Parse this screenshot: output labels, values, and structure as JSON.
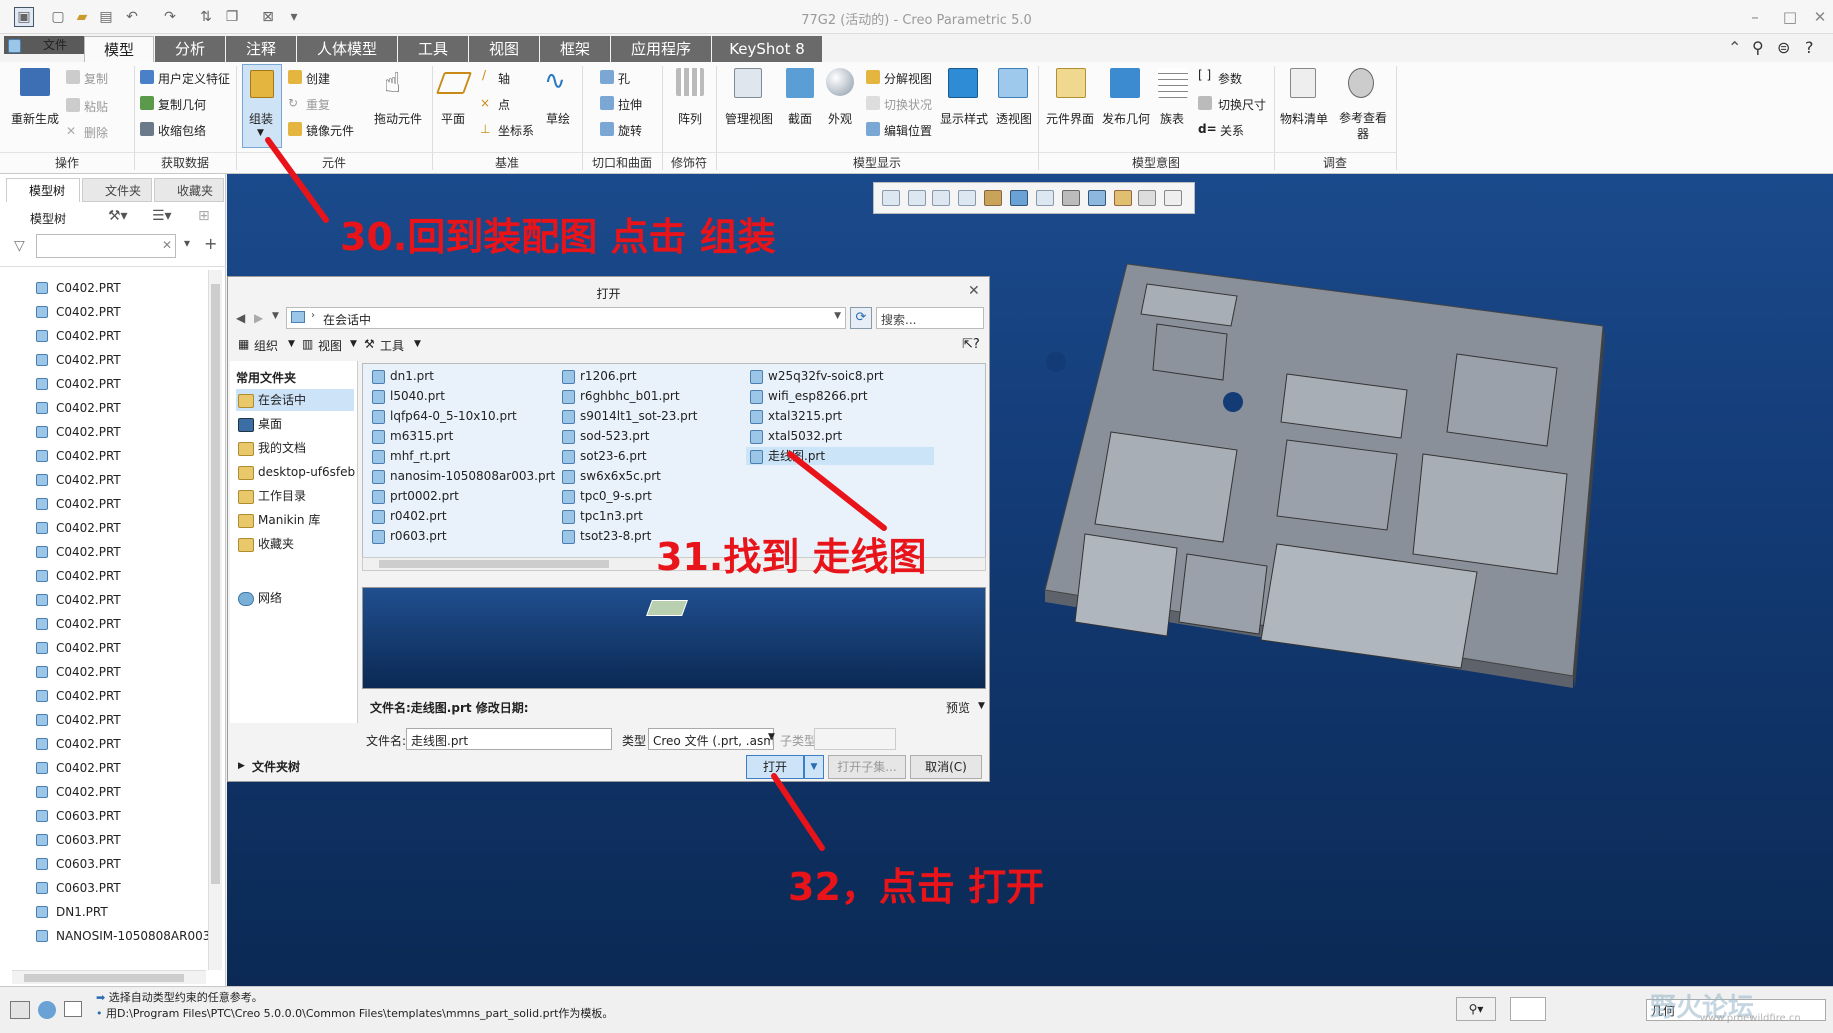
{
  "window": {
    "title": "77G2 (活动的) - Creo Parametric 5.0"
  },
  "tabs": [
    {
      "label": "文件"
    },
    {
      "label": "模型"
    },
    {
      "label": "分析"
    },
    {
      "label": "注释"
    },
    {
      "label": "人体模型"
    },
    {
      "label": "工具"
    },
    {
      "label": "视图"
    },
    {
      "label": "框架"
    },
    {
      "label": "应用程序"
    },
    {
      "label": "KeyShot 8"
    }
  ],
  "ribbon": {
    "regenerate": "重新生成",
    "copy": "复制",
    "paste": "粘贴",
    "delete": "删除",
    "udf": "用户定义特征",
    "copy_geom": "复制几何",
    "shrinkwrap": "收缩包络",
    "assemble": "组装",
    "create": "创建",
    "repeat": "重复",
    "mirror_comp": "镜像元件",
    "drag": "拖动元件",
    "plane": "平面",
    "axis": "轴",
    "point": "点",
    "csys": "坐标系",
    "sketch": "草绘",
    "hole": "孔",
    "extrude": "拉伸",
    "revolve": "旋转",
    "pattern": "阵列",
    "manage_views": "管理视图",
    "section": "截面",
    "appearance": "外观",
    "explode": "分解视图",
    "toggle_status": "切换状况",
    "edit_position": "编辑位置",
    "display_style": "显示样式",
    "perspective": "透视图",
    "comp_interface": "元件界面",
    "publish_geom": "发布几何",
    "family_table": "族表",
    "params": "参数",
    "toggle_dims": "切换尺寸",
    "relations": "关系",
    "bom": "物料清单",
    "ref_viewer": "参考查看器",
    "groups": {
      "operations": "操作",
      "get_data": "获取数据",
      "component": "元件",
      "datum": "基准",
      "cut_surface": "切口和曲面",
      "modifiers": "修饰符",
      "model_display": "模型显示",
      "model_intent": "模型意图",
      "investigate": "调查"
    }
  },
  "left_panel": {
    "tabs": [
      "模型树",
      "文件夹",
      "收藏夹"
    ],
    "tree_header": "模型树",
    "items": [
      "C0402.PRT",
      "C0402.PRT",
      "C0402.PRT",
      "C0402.PRT",
      "C0402.PRT",
      "C0402.PRT",
      "C0402.PRT",
      "C0402.PRT",
      "C0402.PRT",
      "C0402.PRT",
      "C0402.PRT",
      "C0402.PRT",
      "C0402.PRT",
      "C0402.PRT",
      "C0402.PRT",
      "C0402.PRT",
      "C0402.PRT",
      "C0402.PRT",
      "C0402.PRT",
      "C0402.PRT",
      "C0402.PRT",
      "C0402.PRT",
      "C0603.PRT",
      "C0603.PRT",
      "C0603.PRT",
      "C0603.PRT",
      "DN1.PRT",
      "NANOSIM-1050808AR003"
    ]
  },
  "dialog": {
    "title": "打开",
    "location": "在会话中",
    "search_placeholder": "搜索...",
    "toolbar": {
      "organize": "组织",
      "view": "视图",
      "tools": "工具"
    },
    "sidebar_header": "常用文件夹",
    "sidebar": [
      "在会话中",
      "桌面",
      "我的文档",
      "desktop-uf6sfeb",
      "工作目录",
      "Manikin 库",
      "收藏夹"
    ],
    "network": "网络",
    "files_col1": [
      "dn1.prt",
      "l5040.prt",
      "lqfp64-0_5-10x10.prt",
      "m6315.prt",
      "mhf_rt.prt",
      "nanosim-1050808ar003.prt",
      "prt0002.prt",
      "r0402.prt",
      "r0603.prt"
    ],
    "files_col2": [
      "r1206.prt",
      "r6ghbhc_b01.prt",
      "s9014lt1_sot-23.prt",
      "sod-523.prt",
      "sot23-6.prt",
      "sw6x6x5c.prt",
      "tpc0_9-s.prt",
      "tpc1n3.prt",
      "tsot23-8.prt"
    ],
    "files_col3": [
      "w25q32fv-soic8.prt",
      "wifi_esp8266.prt",
      "xtal3215.prt",
      "xtal5032.prt",
      "走线图.prt"
    ],
    "info_line": "文件名:走线图.prt  修改日期:",
    "preview": "预览",
    "filename_label": "文件名:",
    "filename_value": "走线图.prt",
    "type_label": "类型",
    "type_value": "Creo 文件 (.prt, .asm,",
    "subtype_label": "子类型",
    "folder_tree": "文件夹树",
    "open": "打开",
    "open_sub": "打开子集...",
    "cancel": "取消(C)"
  },
  "annotations": {
    "step30": "30.回到装配图  点击 组装",
    "step31": "31.找到  走线图",
    "step32": "32，点击  打开"
  },
  "status": {
    "line1": "选择自动类型约束的任意参考。",
    "line2": "用D:\\Program Files\\PTC\\Creo 5.0.0.0\\Common Files\\templates\\mmns_part_solid.prt作为模板。",
    "filter": "几何"
  },
  "watermark": {
    "text": "野火论坛",
    "url": "www.proewildfire.cn"
  }
}
